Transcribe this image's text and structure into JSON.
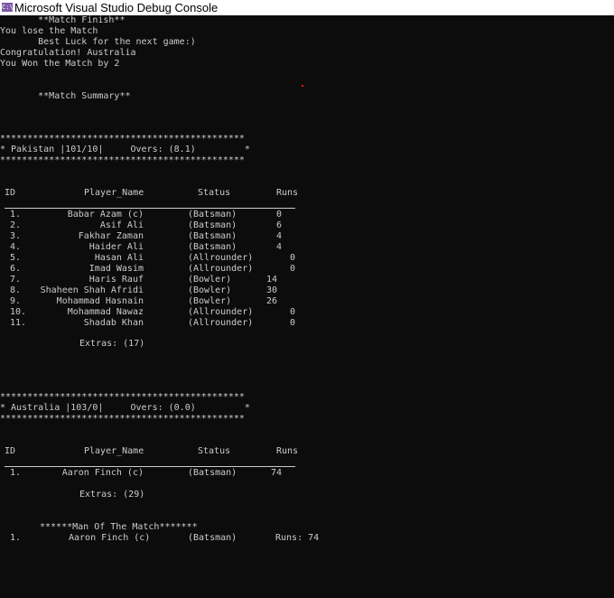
{
  "window": {
    "title": "Microsoft Visual Studio Debug Console",
    "icon_name": "vs-debug-console-icon",
    "icon_text": "C:\\"
  },
  "result": {
    "finish": "       **Match Finish**",
    "lose": "You lose the Match",
    "luck": "       Best Luck for the next game:)",
    "congrats": "Congratulation! Australia",
    "won": "You Won the Match by 2"
  },
  "summary_heading": "       **Match Summary**",
  "stars": "*********************************************",
  "table_headers": {
    "id": "ID",
    "name": "Player_Name",
    "status": "Status",
    "runs": "Runs"
  },
  "team1": {
    "banner": "* Pakistan |101/10|     Overs: (8.1)         *",
    "players": [
      {
        "id": "1.",
        "name": "Babar Azam (c)",
        "status": "(Batsman)",
        "runs": "0",
        "runs_col": "a"
      },
      {
        "id": "2.",
        "name": "Asif Ali",
        "status": "(Batsman)",
        "runs": "6",
        "runs_col": "a"
      },
      {
        "id": "3.",
        "name": "Fakhar Zaman",
        "status": "(Batsman)",
        "runs": "4",
        "runs_col": "a"
      },
      {
        "id": "4.",
        "name": "Haider Ali",
        "status": "(Batsman)",
        "runs": "4",
        "runs_col": "a"
      },
      {
        "id": "5.",
        "name": "Hasan Ali",
        "status": "(Allrounder)",
        "runs": "0",
        "runs_col": "c"
      },
      {
        "id": "6.",
        "name": "Imad Wasim",
        "status": "(Allrounder)",
        "runs": "0",
        "runs_col": "c"
      },
      {
        "id": "7.",
        "name": "Haris Rauf",
        "status": "(Bowler)",
        "runs": "14",
        "runs_col": "b"
      },
      {
        "id": "8.",
        "name": "Shaheen Shah Afridi",
        "status": "(Bowler)",
        "runs": "30",
        "runs_col": "b"
      },
      {
        "id": "9.",
        "name": "Mohammad Hasnain",
        "status": "(Bowler)",
        "runs": "26",
        "runs_col": "b"
      },
      {
        "id": "10.",
        "name": "Mohammad Nawaz",
        "status": "(Allrounder)",
        "runs": "0",
        "runs_col": "c"
      },
      {
        "id": "11.",
        "name": "Shadab Khan",
        "status": "(Allrounder)",
        "runs": "0",
        "runs_col": "c"
      }
    ],
    "extras": "Extras: (17)"
  },
  "team2": {
    "banner": "* Australia |103/0|     Overs: (0.0)         *",
    "players": [
      {
        "id": "1.",
        "name": "Aaron Finch (c)",
        "status": "(Batsman)",
        "runs": "74",
        "runs_col": "d"
      }
    ],
    "extras": "Extras: (29)"
  },
  "motm": {
    "heading": "******Man Of The Match*******",
    "id": "1.",
    "name": "Aaron Finch (c)",
    "status": "(Batsman)",
    "runs": "Runs: 74"
  },
  "colors": {
    "background": "#0c0c0c",
    "text": "#cccccc",
    "titlebar": "#ffffff"
  }
}
